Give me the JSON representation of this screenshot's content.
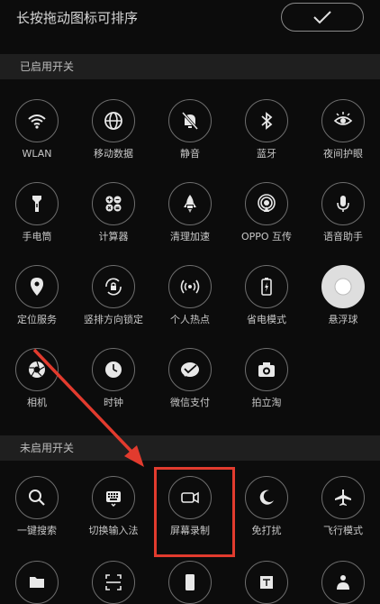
{
  "header": {
    "title": "长按拖动图标可排序",
    "confirm_icon": "checkmark-icon"
  },
  "enabled_section": {
    "title": "已启用开关",
    "tiles": [
      {
        "label": "WLAN",
        "icon": "wifi-icon"
      },
      {
        "label": "移动数据",
        "icon": "globe-icon"
      },
      {
        "label": "静音",
        "icon": "bell-off-icon"
      },
      {
        "label": "蓝牙",
        "icon": "bluetooth-icon"
      },
      {
        "label": "夜间护眼",
        "icon": "eye-sun-icon"
      },
      {
        "label": "手电筒",
        "icon": "flashlight-icon"
      },
      {
        "label": "计算器",
        "icon": "calculator-icon"
      },
      {
        "label": "清理加速",
        "icon": "rocket-icon"
      },
      {
        "label": "OPPO 互传",
        "icon": "share-radar-icon"
      },
      {
        "label": "语音助手",
        "icon": "microphone-icon"
      },
      {
        "label": "定位服务",
        "icon": "location-pin-icon"
      },
      {
        "label": "竖排方向锁定",
        "icon": "rotation-lock-icon"
      },
      {
        "label": "个人热点",
        "icon": "hotspot-icon"
      },
      {
        "label": "省电模式",
        "icon": "battery-icon"
      },
      {
        "label": "悬浮球",
        "icon": "float-ball-icon"
      },
      {
        "label": "相机",
        "icon": "aperture-icon"
      },
      {
        "label": "时钟",
        "icon": "clock-icon"
      },
      {
        "label": "微信支付",
        "icon": "wechat-pay-icon"
      },
      {
        "label": "拍立淘",
        "icon": "camera-icon"
      }
    ]
  },
  "disabled_section": {
    "title": "未启用开关",
    "tiles": [
      {
        "label": "一键搜索",
        "icon": "search-icon"
      },
      {
        "label": "切换输入法",
        "icon": "keyboard-icon"
      },
      {
        "label": "屏幕录制",
        "icon": "video-camera-icon"
      },
      {
        "label": "免打扰",
        "icon": "moon-icon"
      },
      {
        "label": "飞行模式",
        "icon": "airplane-icon"
      }
    ]
  },
  "annotation": {
    "color": "#e23b2e"
  }
}
